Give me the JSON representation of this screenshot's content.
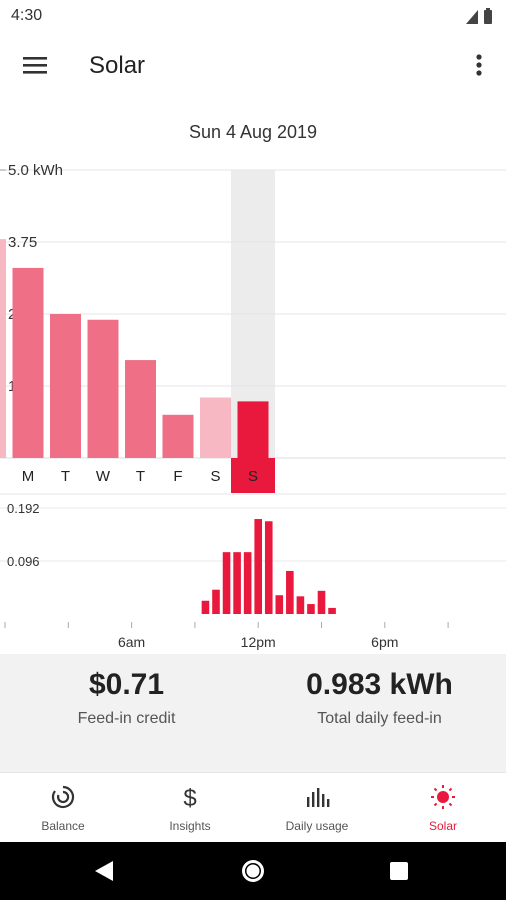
{
  "status_bar": {
    "time": "4:30"
  },
  "app_bar": {
    "title": "Solar"
  },
  "date_label": "Sun 4 Aug 2019",
  "colors": {
    "accent": "#e8193c",
    "bar": "#ef6f86",
    "bar_light": "#f7b8c3",
    "selected_bg": "#ececec"
  },
  "chart_data": [
    {
      "type": "bar",
      "categories": [
        "M",
        "T",
        "W",
        "T",
        "F",
        "S",
        "S"
      ],
      "values": [
        3.3,
        2.5,
        2.4,
        1.7,
        0.75,
        1.05,
        0.983
      ],
      "selected_index": 6,
      "partial_previous_value": 3.8,
      "ylim": [
        0,
        5.0
      ],
      "yticks": [
        "5.0 kWh",
        "3.75",
        "2.5",
        "1.25"
      ],
      "ytick_values": [
        5.0,
        3.75,
        2.5,
        1.25
      ]
    },
    {
      "type": "bar",
      "x": [
        9.5,
        10,
        10.5,
        11,
        11.5,
        12,
        12.5,
        13,
        13.5,
        14,
        14.5,
        15,
        15.5
      ],
      "values": [
        0.024,
        0.044,
        0.112,
        0.112,
        0.112,
        0.172,
        0.168,
        0.034,
        0.078,
        0.032,
        0.018,
        0.042,
        0.011
      ],
      "ylim": [
        0,
        0.192
      ],
      "yticks": [
        "0.192",
        "0.096"
      ],
      "ytick_values": [
        0.192,
        0.096
      ],
      "xtick_labels": [
        "6am",
        "12pm",
        "6pm"
      ],
      "xtick_hours": [
        6,
        12,
        18
      ]
    }
  ],
  "summary": {
    "feed_in_credit": {
      "value": "$0.71",
      "label": "Feed-in credit"
    },
    "daily_feed_in": {
      "value": "0.983 kWh",
      "label": "Total daily feed-in"
    }
  },
  "bottom_nav": {
    "items": [
      {
        "label": "Balance",
        "icon": "balance-icon",
        "active": false
      },
      {
        "label": "Insights",
        "icon": "dollar-icon",
        "active": false
      },
      {
        "label": "Daily usage",
        "icon": "bar-chart-icon",
        "active": false
      },
      {
        "label": "Solar",
        "icon": "sun-icon",
        "active": true
      }
    ]
  }
}
